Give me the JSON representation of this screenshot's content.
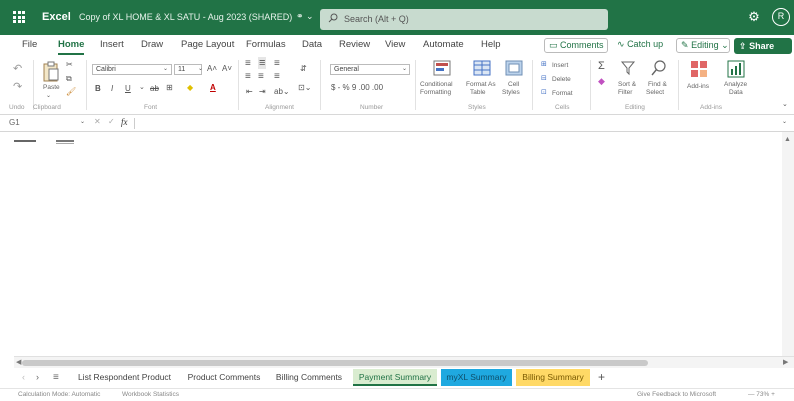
{
  "titlebar": {
    "app_name": "Excel",
    "document_title": "Copy of XL HOME & XL SATU - Aug 2023 (SHARED)",
    "doc_menu_glyph": "⚭ ⌄",
    "search_placeholder": "Search (Alt + Q)",
    "avatar_initial": "R"
  },
  "menu": {
    "tabs": [
      "File",
      "Home",
      "Insert",
      "Draw",
      "Page Layout",
      "Formulas",
      "Data",
      "Review",
      "View",
      "Automate",
      "Help"
    ],
    "comments": "Comments",
    "catch_up": "Catch up",
    "editing": "Editing",
    "share": "Share"
  },
  "ribbon": {
    "paste": "Paste",
    "clipboard_label": "Clipboard",
    "font_name": "Calibri",
    "font_size": "11",
    "font_label": "Font",
    "alignment_label": "Alignment",
    "number_format": "General",
    "number_glyphs": "$ - % 9 .00 .00",
    "number_label": "Number",
    "conditional_formatting": [
      "Conditional",
      "Formatting"
    ],
    "format_as_table": [
      "Format As",
      "Table"
    ],
    "cell_styles": [
      "Cell",
      "Styles"
    ],
    "styles_label": "Styles",
    "insert": "Insert",
    "delete": "Delete",
    "format": "Format",
    "cells_label": "Cells",
    "sort_filter": [
      "Sort &",
      "Filter"
    ],
    "find_select": [
      "Find &",
      "Select"
    ],
    "editing_label": "Editing",
    "add_ins": "Add-ins",
    "analyze_data": [
      "Analyze",
      "Data"
    ],
    "addins_label": "Add-ins",
    "undo_label": "Undo"
  },
  "formula_bar": {
    "name_box": "G1",
    "fx": "fx"
  },
  "sheets": {
    "tabs": [
      "List Respondent Product",
      "Product Comments",
      "Billing Comments",
      "Payment Summary",
      "myXL Summary",
      "Billing Summary"
    ],
    "active": "Payment Summary",
    "add": "+"
  },
  "statusbar": {
    "calc_mode": "Calculation Mode: Automatic",
    "stats": "Workbook Statistics",
    "feedback": "Give Feedback to Microsoft",
    "zoom": "— 73% +"
  },
  "colors": {
    "brand": "#217346",
    "active_tab": "#d9ecd0",
    "blue_tab": "#1fa9e0",
    "yellow_tab": "#ffd966"
  }
}
